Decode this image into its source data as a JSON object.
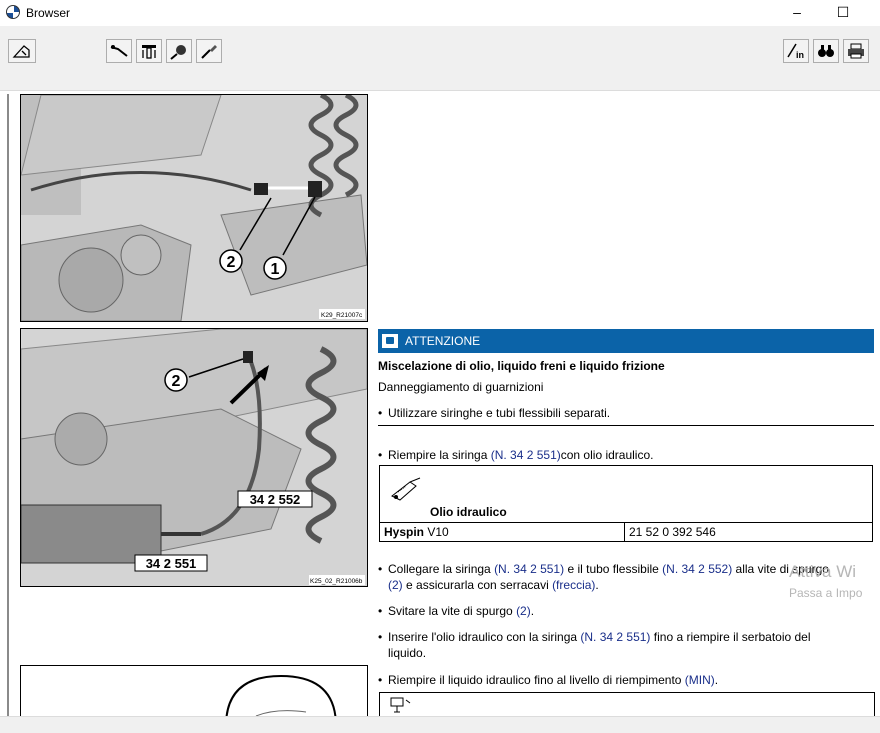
{
  "window": {
    "title": "Browser",
    "minimize": "–",
    "maximize": "☐"
  },
  "toolbar": {
    "left_buttons": [
      "home-icon",
      "wrench-icon",
      "tool-icon",
      "probe-icon",
      "screwdriver-icon"
    ],
    "right_buttons": [
      "pen-in-icon",
      "binoculars-icon",
      "print-icon"
    ]
  },
  "images": [
    {
      "callouts": [
        "2",
        "1"
      ],
      "code": "K29_R21007c"
    },
    {
      "callouts": [
        "2",
        "34 2 552",
        "34 2 551"
      ],
      "code": "K25_02_R21006b"
    }
  ],
  "warning": {
    "label": "ATTENZIONE",
    "heading": "Miscelazione di olio, liquido freni e liquido frizione",
    "subheading": "Danneggiamento di guarnizioni",
    "bullet": "Utilizzare siringhe e tubi flessibili separati."
  },
  "steps": {
    "s1": {
      "a": "Riempire la siringa ",
      "link": "(N. 34 2 551)",
      "b": "con olio idraulico."
    },
    "s2": {
      "a": "Collegare la siringa ",
      "link1": "(N. 34 2 551)",
      "b": " e il tubo flessibile ",
      "link2": "(N. 34 2 552)",
      "c": " alla vite di spurgo",
      "link3": "(2)",
      "d": " e assicurarla con serracavi ",
      "link4": "(freccia)",
      "e": "."
    },
    "s3": {
      "a": "Svitare la vite di spurgo ",
      "link": "(2)",
      "b": "."
    },
    "s4": {
      "a": "Inserire l'olio idraulico con la siringa ",
      "link": "(N. 34 2 551)",
      "b": " fino a riempire il serbatoio del",
      "line2": "liquido."
    },
    "s5": {
      "a": "Riempire il liquido idraulico fino al livello di riempimento ",
      "link": "(MIN)",
      "b": "."
    }
  },
  "oil_table": {
    "title": "Olio idraulico",
    "product_bold": "Hyspin",
    "product_rest": " V10",
    "part_number": "21 52 0 392 546"
  },
  "watermark": {
    "line1": "Attiva Wi",
    "line2": "Passa a Impo"
  }
}
